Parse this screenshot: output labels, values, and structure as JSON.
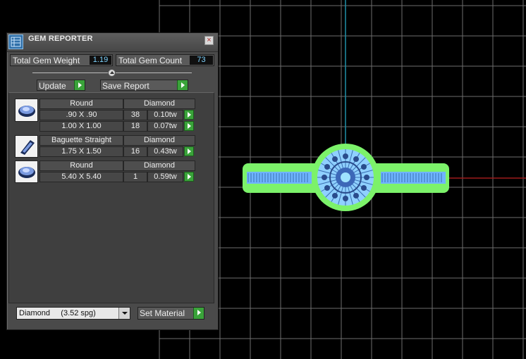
{
  "panel": {
    "title": "GEM REPORTER",
    "close_glyph": "×",
    "logo_icon": "gem-reporter-logo-icon",
    "total_weight_label": "Total Gem Weight",
    "total_weight_value": "1.19",
    "total_count_label": "Total Gem Count",
    "total_count_value": "73",
    "update_label": "Update",
    "save_report_label": "Save Report",
    "gems": [
      {
        "icon": "round-gem-icon",
        "shape": "Round",
        "material": "Diamond",
        "rows": [
          {
            "size": ".90 X .90",
            "count": "38",
            "weight": "0.10tw"
          },
          {
            "size": "1.00 X 1.00",
            "count": "18",
            "weight": "0.07tw"
          }
        ]
      },
      {
        "icon": "baguette-gem-icon",
        "shape": "Baguette Straight",
        "material": "Diamond",
        "rows": [
          {
            "size": "1.75 X 1.50",
            "count": "16",
            "weight": "0.43tw"
          }
        ]
      },
      {
        "icon": "round-gem-icon",
        "shape": "Round",
        "material": "Diamond",
        "rows": [
          {
            "size": "5.40 X 5.40",
            "count": "1",
            "weight": "0.59tw"
          }
        ]
      }
    ],
    "material_select_value": "Diamond     (3.52 spg)",
    "set_material_label": "Set Material"
  },
  "colors": {
    "grid_line": "#6e6e6e",
    "axis_y": "#1f8fa8",
    "axis_x": "#9e1b1b",
    "model_green": "#7cf26a",
    "model_blue": "#6fb4ff",
    "action_green": "#3aa33a",
    "value_text": "#7fd4ff"
  }
}
